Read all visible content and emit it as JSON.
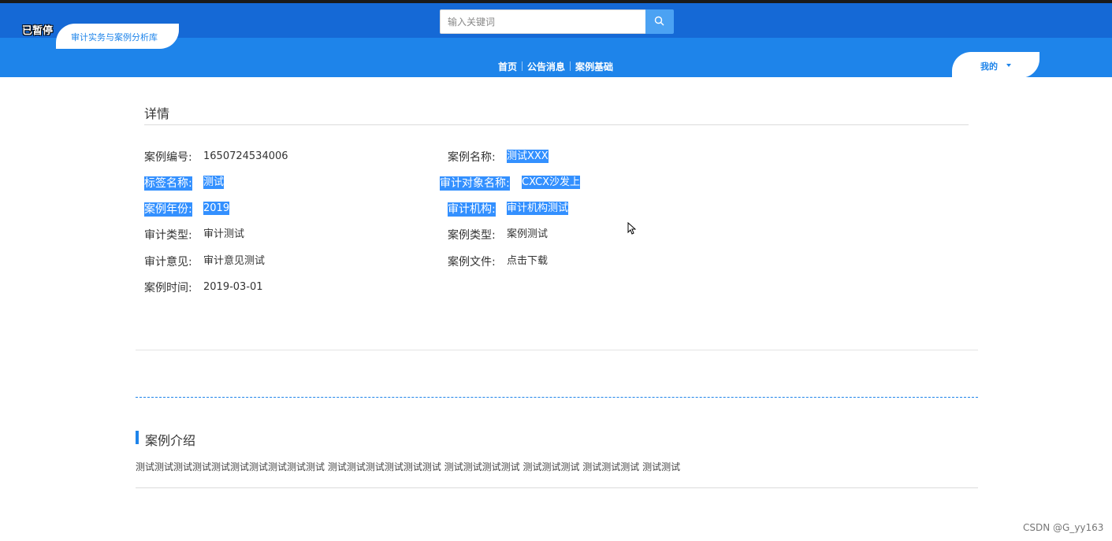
{
  "overlay": {
    "paused_label": "已暂停"
  },
  "header": {
    "brand": "审计实务与案例分析库",
    "search": {
      "placeholder": "输入关键词",
      "value": ""
    },
    "nav": [
      "首页",
      "公告消息",
      "案例基础"
    ],
    "user_menu": "我的"
  },
  "detail": {
    "title": "详情",
    "fields": {
      "case_no": {
        "label": "案例编号:",
        "value": "1650724534006"
      },
      "case_name": {
        "label": "案例名称:",
        "value": "测试XXX"
      },
      "tag_name": {
        "label": "标签名称:",
        "value": "测试"
      },
      "audit_target": {
        "label": "审计对象名称:",
        "value": "CXCX沙发上"
      },
      "case_year": {
        "label": "案例年份:",
        "value": "2019"
      },
      "audit_org": {
        "label": "审计机构:",
        "value": "审计机构测试"
      },
      "audit_type": {
        "label": "审计类型:",
        "value": "审计测试"
      },
      "case_type": {
        "label": "案例类型:",
        "value": "案例测试"
      },
      "audit_opinion": {
        "label": "审计意见:",
        "value": "审计意见测试"
      },
      "case_file": {
        "label": "案例文件:",
        "value": "点击下载"
      },
      "case_time": {
        "label": "案例时间:",
        "value": "2019-03-01"
      }
    }
  },
  "intro": {
    "title": "案例介绍",
    "text": "测试测试测试测试测试测试测试测试测试测试 测试测试测试测试测试测试 测试测试测试测试 测试测试测试 测试测试测试 测试测试"
  },
  "watermark": "CSDN @G_yy163",
  "colors": {
    "header_dark": "#1569d6",
    "header_light": "#1e84ea",
    "selection": "#3390ff"
  }
}
